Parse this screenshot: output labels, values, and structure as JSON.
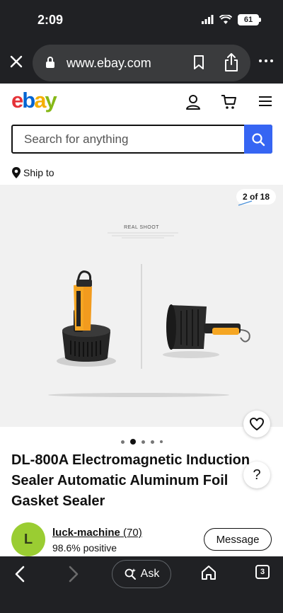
{
  "status_bar": {
    "time": "2:09",
    "battery": "61"
  },
  "browser": {
    "url": "www.ebay.com"
  },
  "header": {
    "logo": {
      "e": "e",
      "b": "b",
      "a": "a",
      "y": "y"
    },
    "icons": [
      "user-icon",
      "cart-icon",
      "menu-icon"
    ]
  },
  "search": {
    "placeholder": "Search for anything",
    "value": ""
  },
  "ship_to": {
    "label": "Ship to"
  },
  "gallery": {
    "counter": "2 of 18",
    "image_caption": "REAL SHOOT",
    "total_dots": 5,
    "active_dot": 2
  },
  "listing": {
    "title": "DL-800A Electromagnetic Induction Sealer Automatic Aluminum Foil Gasket Sealer"
  },
  "seller": {
    "initial": "L",
    "name": "luck-machine",
    "feedback_count": "(70)",
    "positive": "98.6% positive",
    "message_label": "Message"
  },
  "bottom_bar": {
    "ask_label": "Ask",
    "tab_count": "3"
  },
  "colors": {
    "accent": "#3665f3",
    "browser_bg": "#202124",
    "avatar": "#9acd32"
  }
}
